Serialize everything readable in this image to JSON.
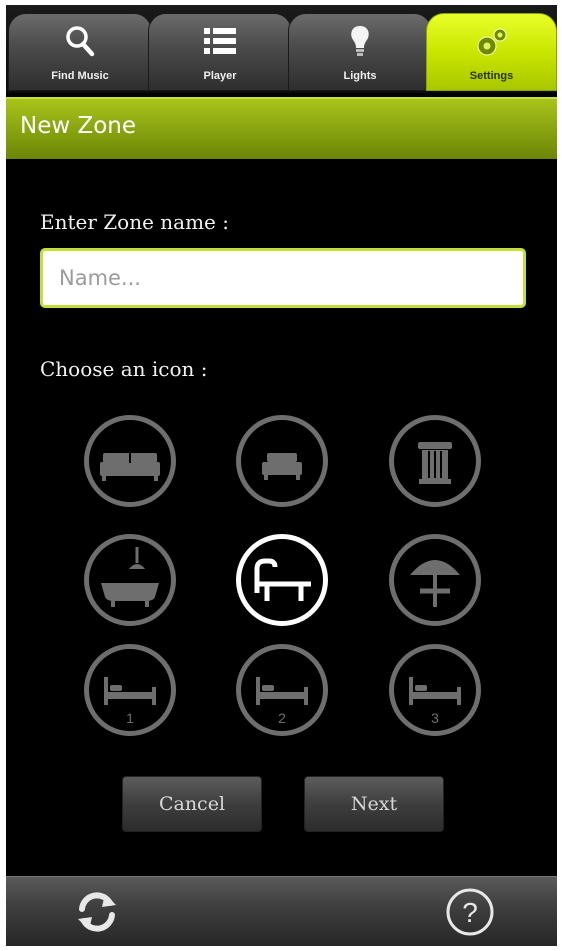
{
  "tabs": [
    {
      "label": "Find Music",
      "icon": "search-icon"
    },
    {
      "label": "Player",
      "icon": "list-icon"
    },
    {
      "label": "Lights",
      "icon": "bulb-icon"
    },
    {
      "label": "Settings",
      "icon": "gears-icon",
      "active": true
    }
  ],
  "header": {
    "title": "New Zone"
  },
  "form": {
    "name_label": "Enter Zone name :",
    "name_placeholder": "Name...",
    "name_value": "",
    "icon_label": "Choose an icon :"
  },
  "icons": [
    {
      "name": "sofa-icon"
    },
    {
      "name": "couch-icon"
    },
    {
      "name": "column-icon"
    },
    {
      "name": "bathtub-icon"
    },
    {
      "name": "lounger-icon",
      "selected": true
    },
    {
      "name": "parasol-icon"
    },
    {
      "name": "bed-icon",
      "number": "1"
    },
    {
      "name": "bed-icon",
      "number": "2"
    },
    {
      "name": "bed-icon",
      "number": "3"
    }
  ],
  "buttons": {
    "cancel": "Cancel",
    "next": "Next"
  },
  "bottom": {
    "refresh_icon": "refresh-icon",
    "help_icon": "help-icon"
  },
  "colors": {
    "accent": "#b8d41a",
    "tab_active": "#d4ef0a",
    "icon_ring": "#6e6e6e",
    "selected_ring": "#ffffff"
  }
}
